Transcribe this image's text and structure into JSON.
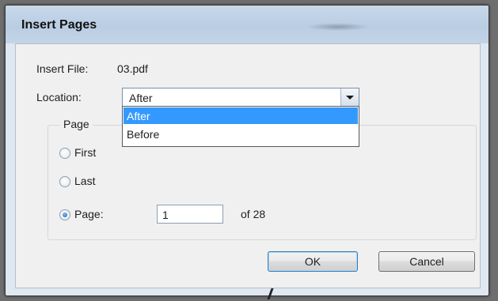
{
  "dialog": {
    "title": "Insert Pages",
    "insert_file_label": "Insert File:",
    "insert_file_value": "03.pdf",
    "location_label": "Location:",
    "location_value": "After",
    "location_options": [
      "After",
      "Before"
    ],
    "location_selected_option": "After"
  },
  "page_group": {
    "title": "Page",
    "options": [
      {
        "label": "First",
        "checked": false
      },
      {
        "label": "Last",
        "checked": false
      },
      {
        "label": "Page:",
        "checked": true
      }
    ],
    "page_number": "1",
    "page_total_text": "of 28"
  },
  "buttons": {
    "ok": "OK",
    "cancel": "Cancel"
  },
  "colors": {
    "selection": "#3399ff",
    "titlebar": "#c3d4e8"
  }
}
